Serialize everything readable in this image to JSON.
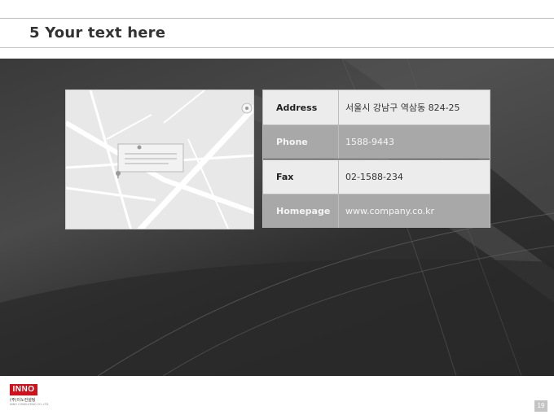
{
  "slide": {
    "title": "5 Your text here",
    "page_number": "19"
  },
  "contact": {
    "rows": [
      {
        "label": "Address",
        "value": "서울시 강남구 역삼동 824-25"
      },
      {
        "label": "Phone",
        "value": "1588-9443"
      },
      {
        "label": "Fax",
        "value": "02-1588-234"
      },
      {
        "label": "Homepage",
        "value": "www.company.co.kr"
      }
    ]
  },
  "logo": {
    "mark": "INNO",
    "name": "(주)이노컨설팅",
    "tagline": "INNO CONSULTING CO.,LTD"
  },
  "colors": {
    "title": "#333333",
    "row_light": "#ececec",
    "row_dark": "#a8a8a8",
    "logo_red": "#d0101b"
  },
  "icons": [
    "map-pin-icon",
    "compass-icon"
  ]
}
